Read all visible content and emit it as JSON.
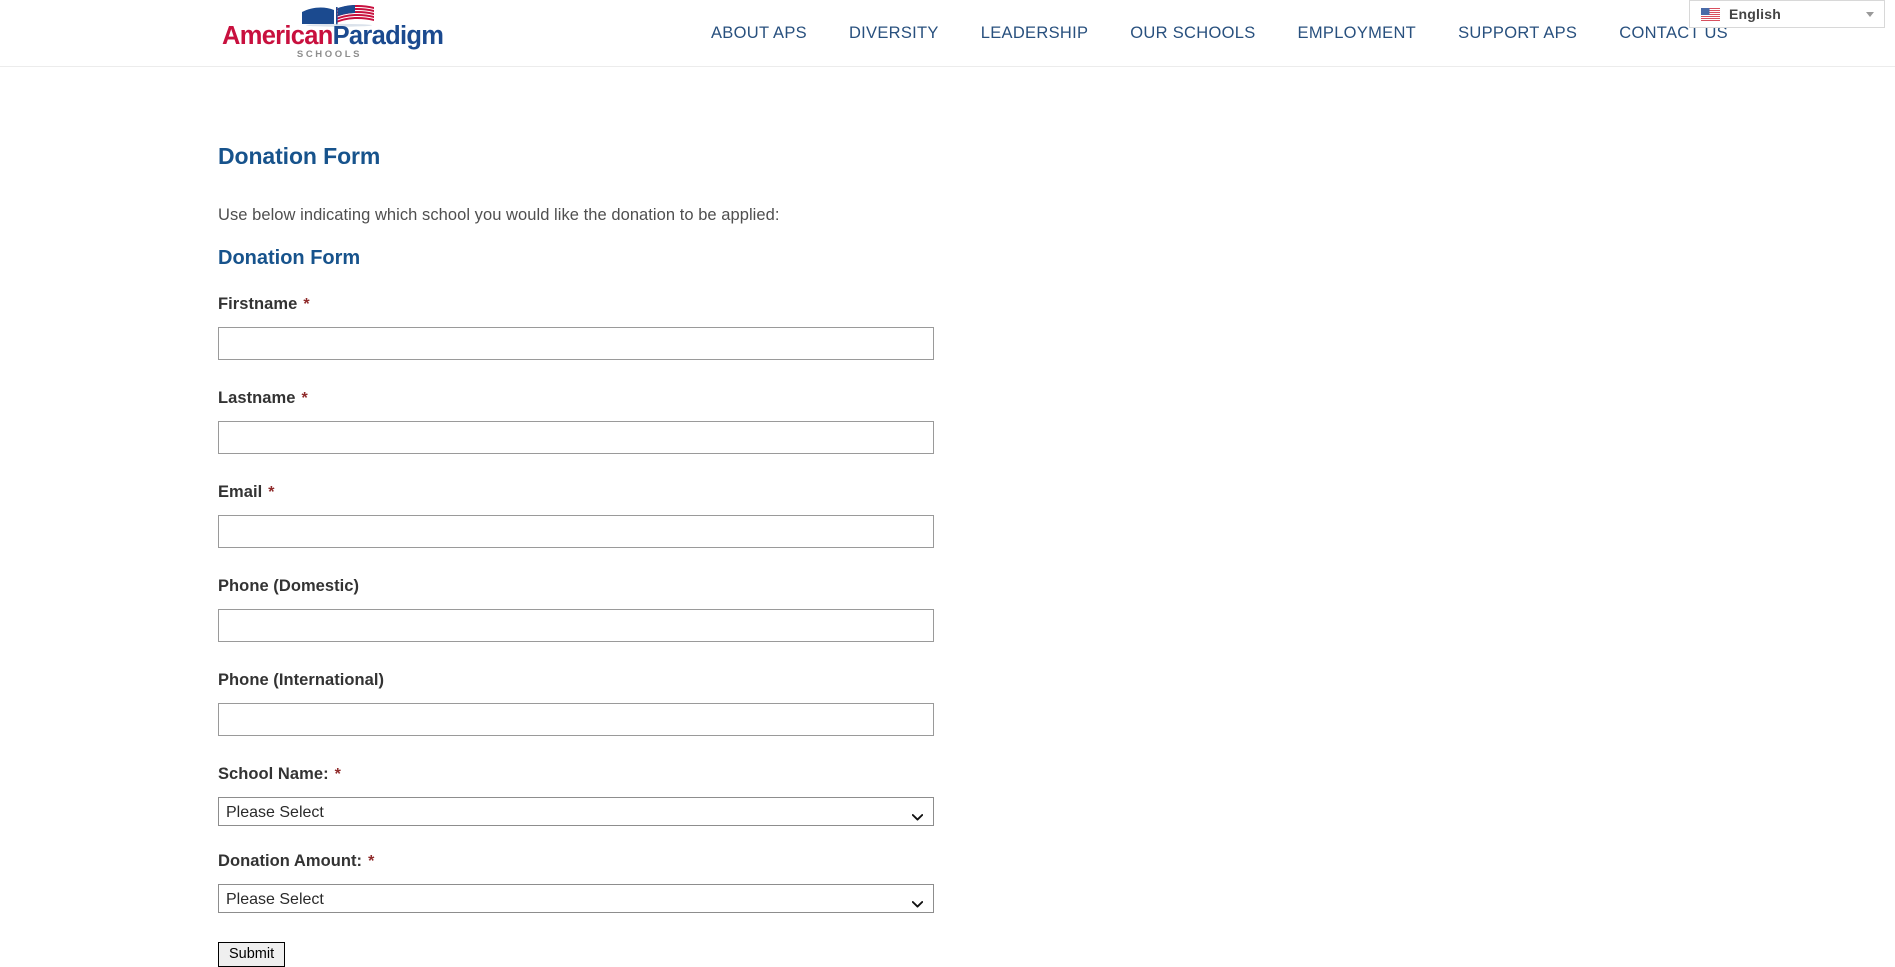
{
  "header": {
    "logo": {
      "text_primary": "American",
      "text_secondary": "Paradigm",
      "subtitle": "SCHOOLS",
      "icon": "flag-book-icon",
      "color_primary": "#c8103e",
      "color_secondary": "#1b4a8f"
    },
    "nav": [
      {
        "label": "ABOUT APS"
      },
      {
        "label": "DIVERSITY"
      },
      {
        "label": "LEADERSHIP"
      },
      {
        "label": "OUR SCHOOLS"
      },
      {
        "label": "EMPLOYMENT"
      },
      {
        "label": "SUPPORT APS"
      },
      {
        "label": "CONTACT US"
      }
    ],
    "nav_color": "#28507e",
    "language_switcher": {
      "label": "English",
      "flag_icon": "us-flag-icon",
      "caret_icon": "chevron-down-icon"
    }
  },
  "main": {
    "page_title": "Donation Form",
    "intro_text": "Use below indicating which school you would like the donation to be applied:",
    "form_title": "Donation Form",
    "heading_color": "#17538c",
    "required_marker": "*",
    "fields": [
      {
        "id": "firstname",
        "label": "Firstname",
        "required": true,
        "type": "text",
        "value": "",
        "placeholder": ""
      },
      {
        "id": "lastname",
        "label": "Lastname",
        "required": true,
        "type": "text",
        "value": "",
        "placeholder": ""
      },
      {
        "id": "email",
        "label": "Email",
        "required": true,
        "type": "text",
        "value": "",
        "placeholder": ""
      },
      {
        "id": "phone_dom",
        "label": "Phone (Domestic)",
        "required": false,
        "type": "text",
        "value": "",
        "placeholder": ""
      },
      {
        "id": "phone_intl",
        "label": "Phone (International)",
        "required": false,
        "type": "text",
        "value": "",
        "placeholder": ""
      },
      {
        "id": "school_name",
        "label": "School Name:",
        "required": true,
        "type": "select",
        "value": "Please Select"
      },
      {
        "id": "donation_amt",
        "label": "Donation Amount:",
        "required": true,
        "type": "select",
        "value": "Please Select"
      }
    ],
    "submit_label": "Submit"
  }
}
